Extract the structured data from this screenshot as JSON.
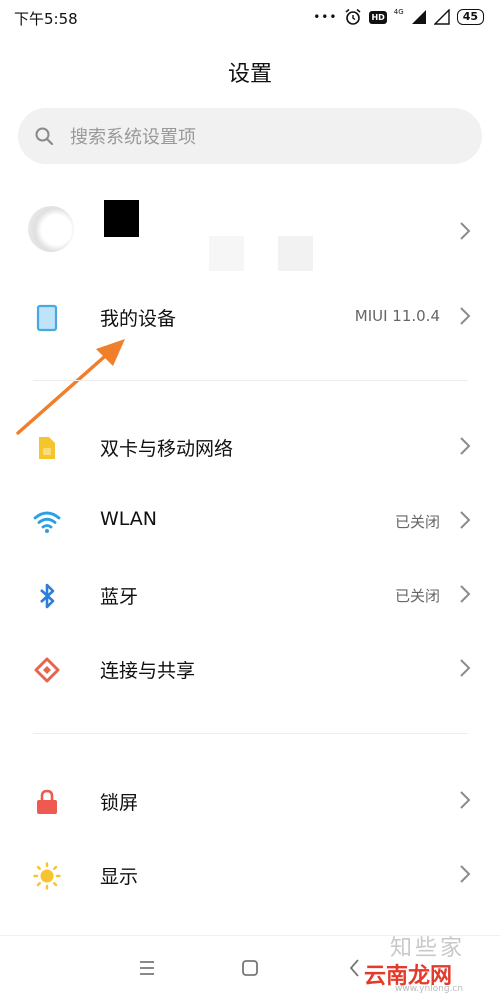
{
  "statusbar": {
    "time": "下午5:58",
    "signal_dots": "•••",
    "hd": "HD",
    "net": "4G",
    "battery": "45"
  },
  "header": {
    "title": "设置"
  },
  "search": {
    "placeholder": "搜索系统设置项"
  },
  "account": {
    "avatar_icon": "avatar-icon"
  },
  "device": {
    "label": "我的设备",
    "value": "MIUI 11.0.4",
    "icon": "phone-icon",
    "color": "#4aa8e0"
  },
  "network": {
    "items": [
      {
        "label": "双卡与移动网络",
        "value": "",
        "icon": "sim-icon",
        "color": "#f5c52e"
      },
      {
        "label": "WLAN",
        "value": "已关闭",
        "icon": "wifi-icon",
        "color": "#2b9fe6"
      },
      {
        "label": "蓝牙",
        "value": "已关闭",
        "icon": "bluetooth-icon",
        "color": "#2b7fd8"
      },
      {
        "label": "连接与共享",
        "value": "",
        "icon": "share-icon",
        "color": "#e8644f"
      }
    ]
  },
  "display": {
    "items": [
      {
        "label": "锁屏",
        "icon": "lock-icon",
        "color": "#ef5a50"
      },
      {
        "label": "显示",
        "icon": "sun-icon",
        "color": "#f7c42f"
      }
    ]
  },
  "navbar": {
    "menu_icon": "menu-icon",
    "home_icon": "home-icon",
    "back_icon": "back-icon"
  },
  "watermark": {
    "text_en": "知些家",
    "text_cn": "云南龙网",
    "url": "www.ynlong.cn"
  },
  "annotation": {
    "arrow_color": "#f07f2c"
  }
}
